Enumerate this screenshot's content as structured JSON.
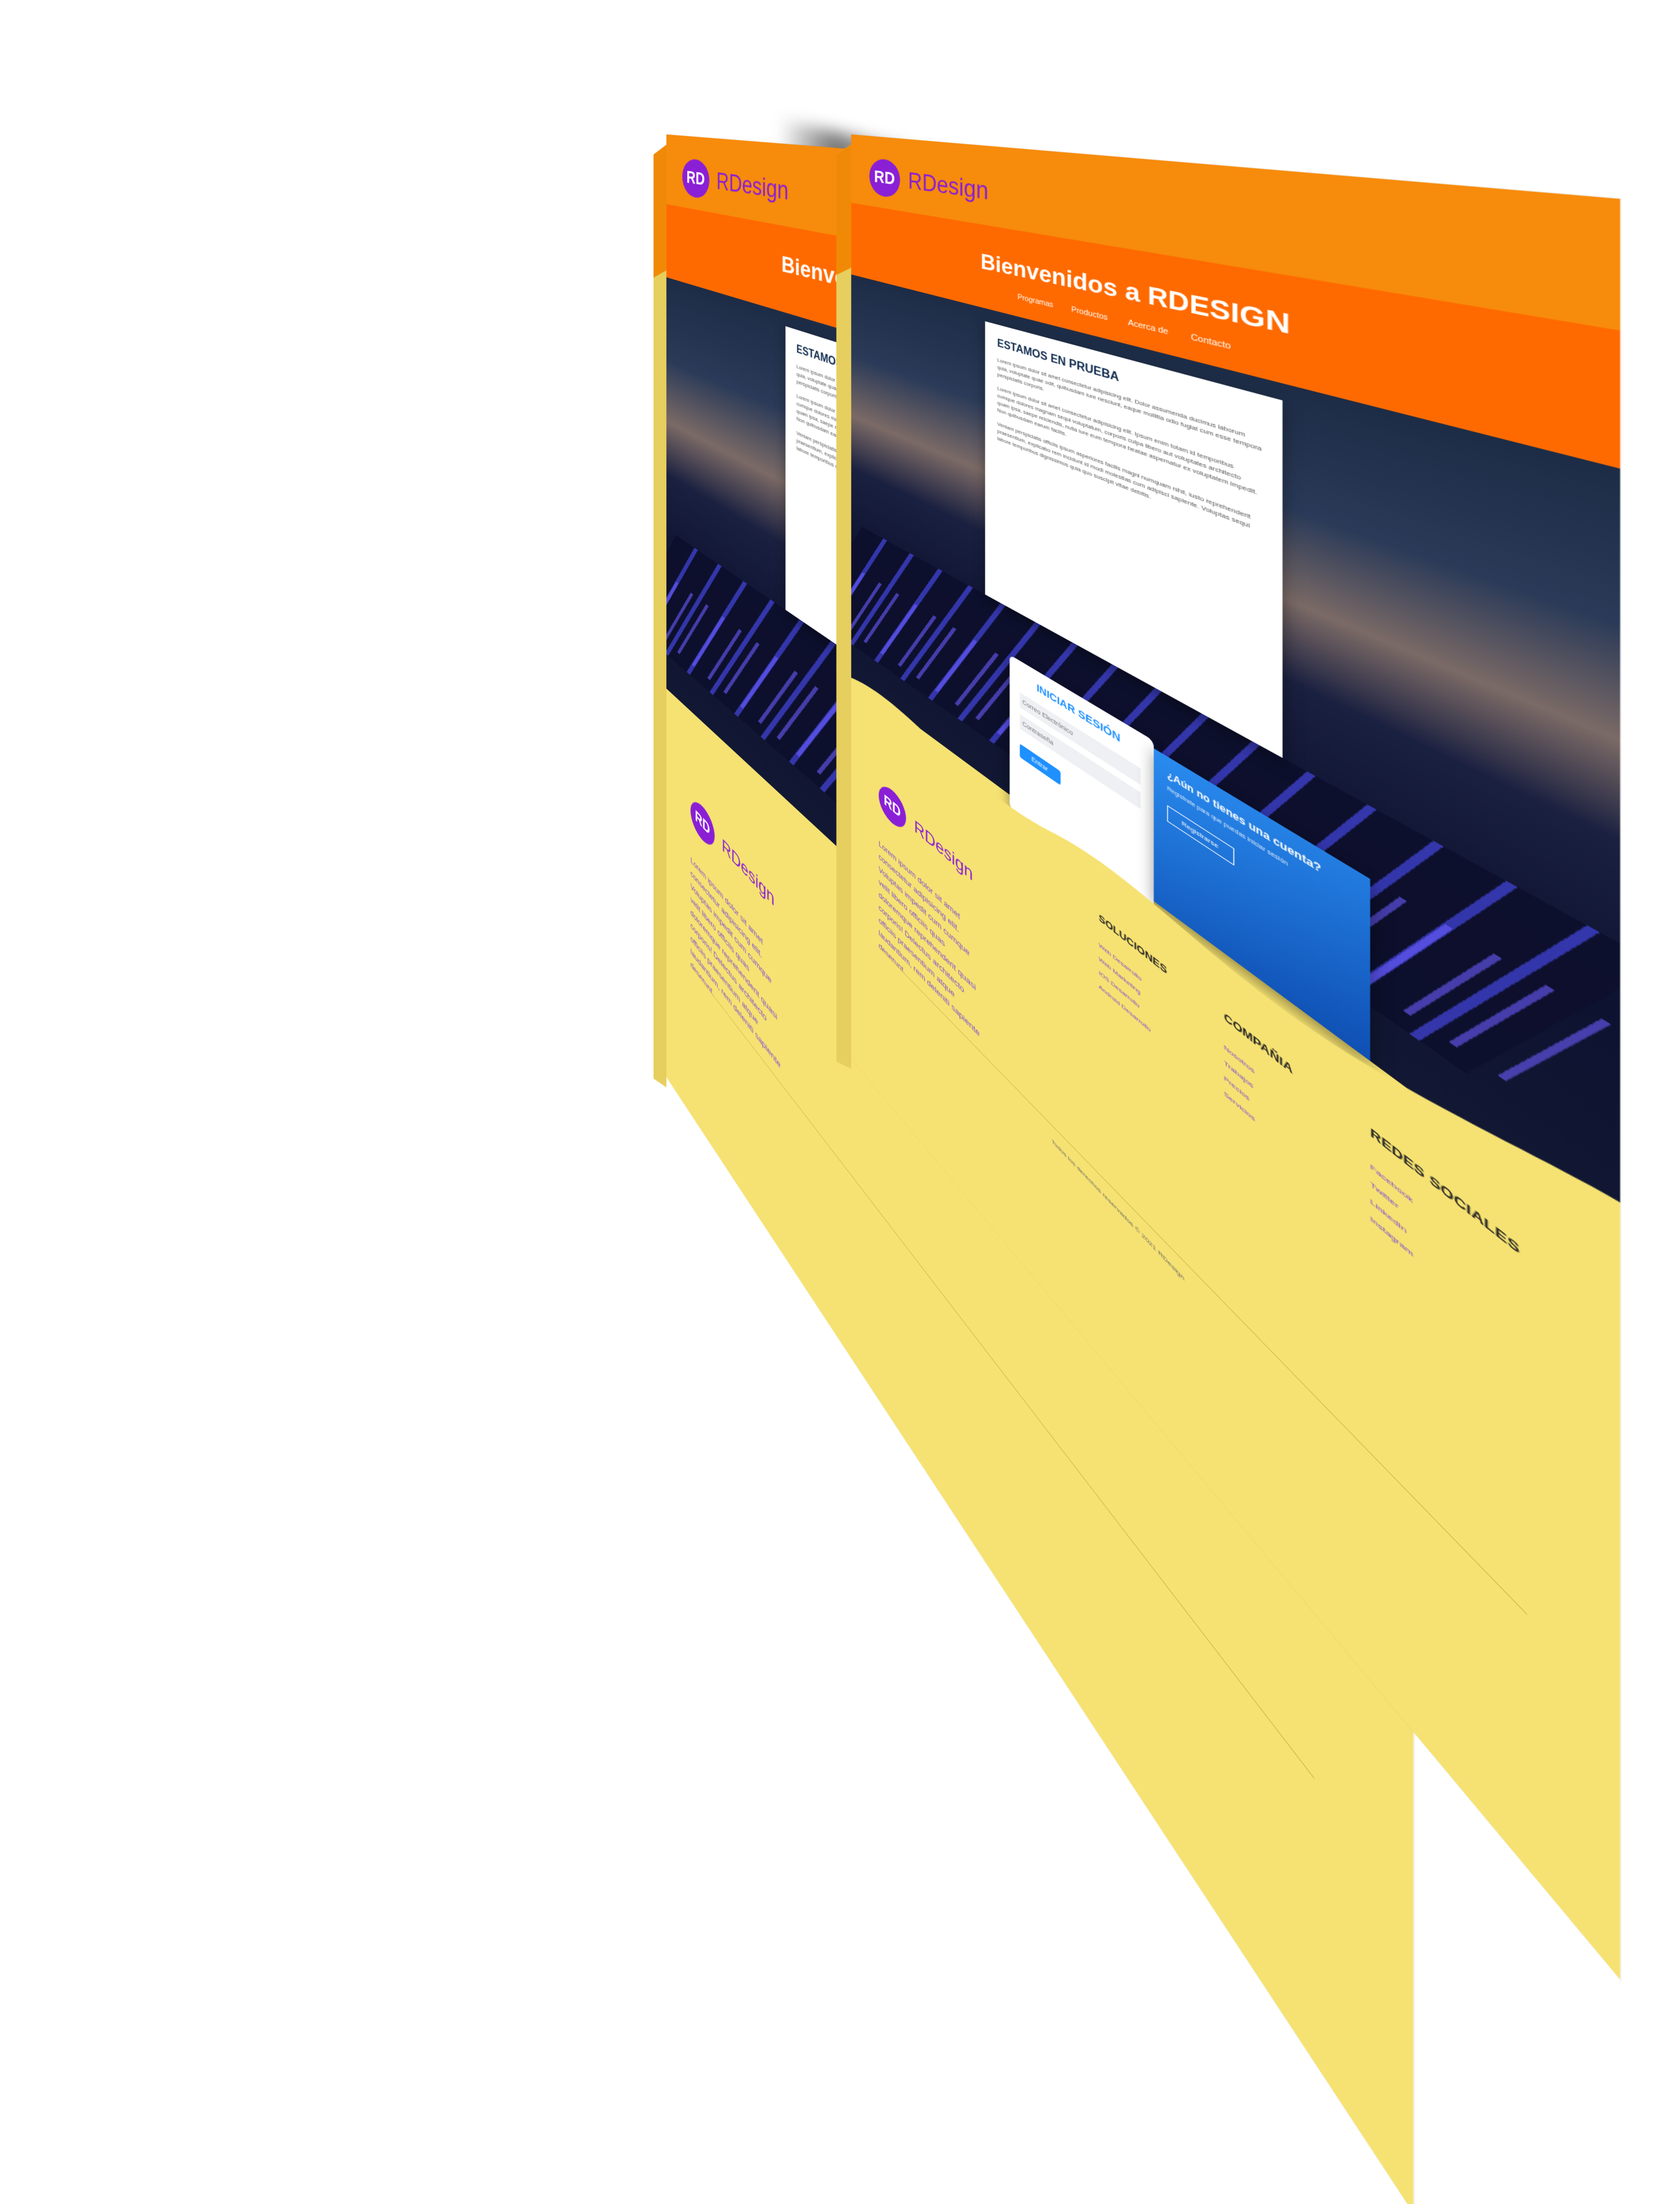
{
  "header": {
    "logo_mark": "RD",
    "logo_text": "RDesign",
    "site_title": "Bienvenidos a RDESIGN",
    "nav": [
      "Programas",
      "Productos",
      "Acerca de",
      "Contacto"
    ]
  },
  "hero": {
    "card_title": "ESTAMOS EN PRUEBA",
    "paragraphs": [
      "Lorem ipsum dolor sit amet consectetur adipisicing elit. Dolor assumenda ducimus laborum quia, voluptate quae odit, quibusdam iure nesciunt, eaque mollitia odio fugiat cum esse tempora perspiciatis corporis.",
      "Lorem ipsum dolor sit amet consectetur adipisicing elit. Ipsum enim totam id temporibus cumque dolores magnam sequi voluptatum, corporis culpa libero aut voluptates architecto quam ipsa, saepe reiciendis, nulla iure eum tempora beatae aspernatur ex voluptatem impedit. Non quibusdam earum facilis.",
      "Veniam perspiciatis officiis ipsum asperiores facilis magni numquam nihil, iusto reprehenderit praesentium, explicabo rem incidunt id modi molestias cum adipisci sapiente. Voluptas sequi labore temporibus dignissimos quia quo suscipit vitae debitis."
    ]
  },
  "login": {
    "title": "INICIAR SESIÓN",
    "email_placeholder": "Correo Electrónico",
    "password_placeholder": "Contraseña",
    "submit_label": "Entrar"
  },
  "register": {
    "title": "¿Aún no tienes una cuenta?",
    "text": "Regístrate para que puedas iniciar sesión",
    "button_label": "Registrarse"
  },
  "footer": {
    "logo_mark": "RD",
    "logo_text": "RDesign",
    "about": "Lorem ipsum dolor sit amet consectetur adipisicing elit. Voluptas impedit cum cumque velit libero officiis quas doloremque reprehenderit quasi corporis! Delectus architecto officiis praesentium atque laudantium, rem deleniti sapiente deserunt.",
    "columns": [
      {
        "title": "SOLUCIONES",
        "links": [
          "Web Desarrollo",
          "Web Marketing",
          "IOS Desarrollo",
          "Android Desarrollo"
        ]
      },
      {
        "title": "COMPAÑIA",
        "links": [
          "Nosotros",
          "Trabajos",
          "Precios",
          "Servicios"
        ]
      },
      {
        "title": "REDES SOCIALES",
        "links": [
          "Facebook",
          "Twitter",
          "LinkedIn",
          "Instagram"
        ]
      }
    ],
    "copyright": "Todos los derechos reservados © 2021 RDesign"
  },
  "colors": {
    "header": "#f78b0b",
    "header_accent": "#ff6a00",
    "brand_purple": "#8a1fd6",
    "footer": "#f6e272",
    "login_accent": "#1e90ff"
  }
}
